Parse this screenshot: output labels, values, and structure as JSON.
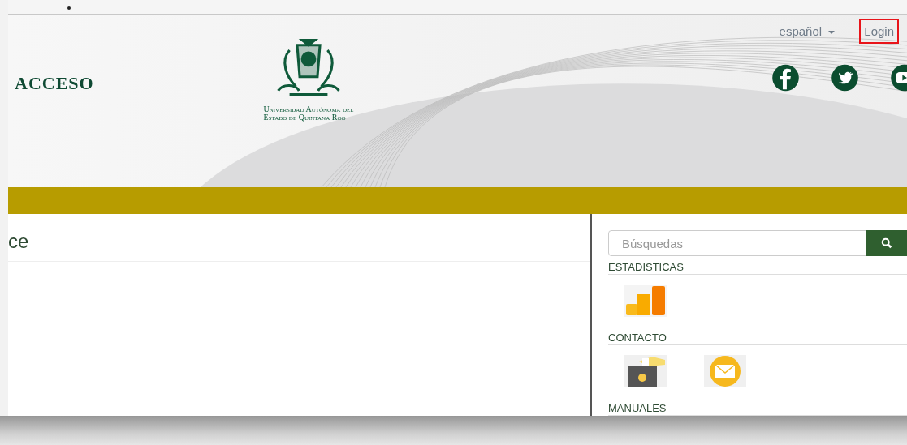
{
  "header": {
    "title": "ACCESO",
    "university": [
      "Universidad Autónoma del",
      "Estado de Quintana Roo"
    ],
    "language": "español",
    "login": {
      "label": "Login",
      "highlighted": true
    }
  },
  "main": {
    "heading": "ce"
  },
  "sidebar": {
    "search": {
      "placeholder": "Búsquedas"
    },
    "sections": [
      {
        "title": "ESTADISTICAS",
        "kind": "stats"
      },
      {
        "title": "CONTACTO",
        "kind": "contact"
      },
      {
        "title": "MANUALES",
        "kind": "manuals"
      }
    ]
  }
}
